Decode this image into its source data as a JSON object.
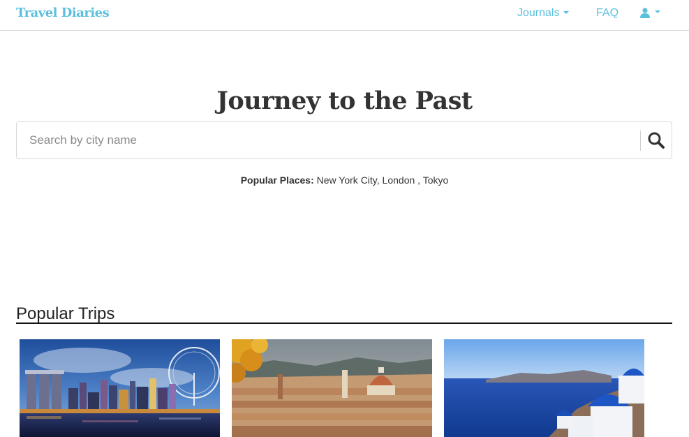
{
  "navbar": {
    "brand": "Travel Diaries",
    "journals_label": "Journals",
    "faq_label": "FAQ",
    "brand_color": "#5bc0de"
  },
  "hero": {
    "title": "Journey to the Past",
    "search": {
      "placeholder": "Search by city name",
      "value": ""
    },
    "popular_label": "Popular Places:",
    "popular_places": [
      "New York City",
      "London",
      "Tokyo"
    ]
  },
  "trips": {
    "heading": "Popular Trips",
    "cards": [
      {
        "image": "singapore-skyline-photo"
      },
      {
        "image": "florence-cityscape-photo"
      },
      {
        "image": "santorini-coast-photo"
      }
    ]
  }
}
